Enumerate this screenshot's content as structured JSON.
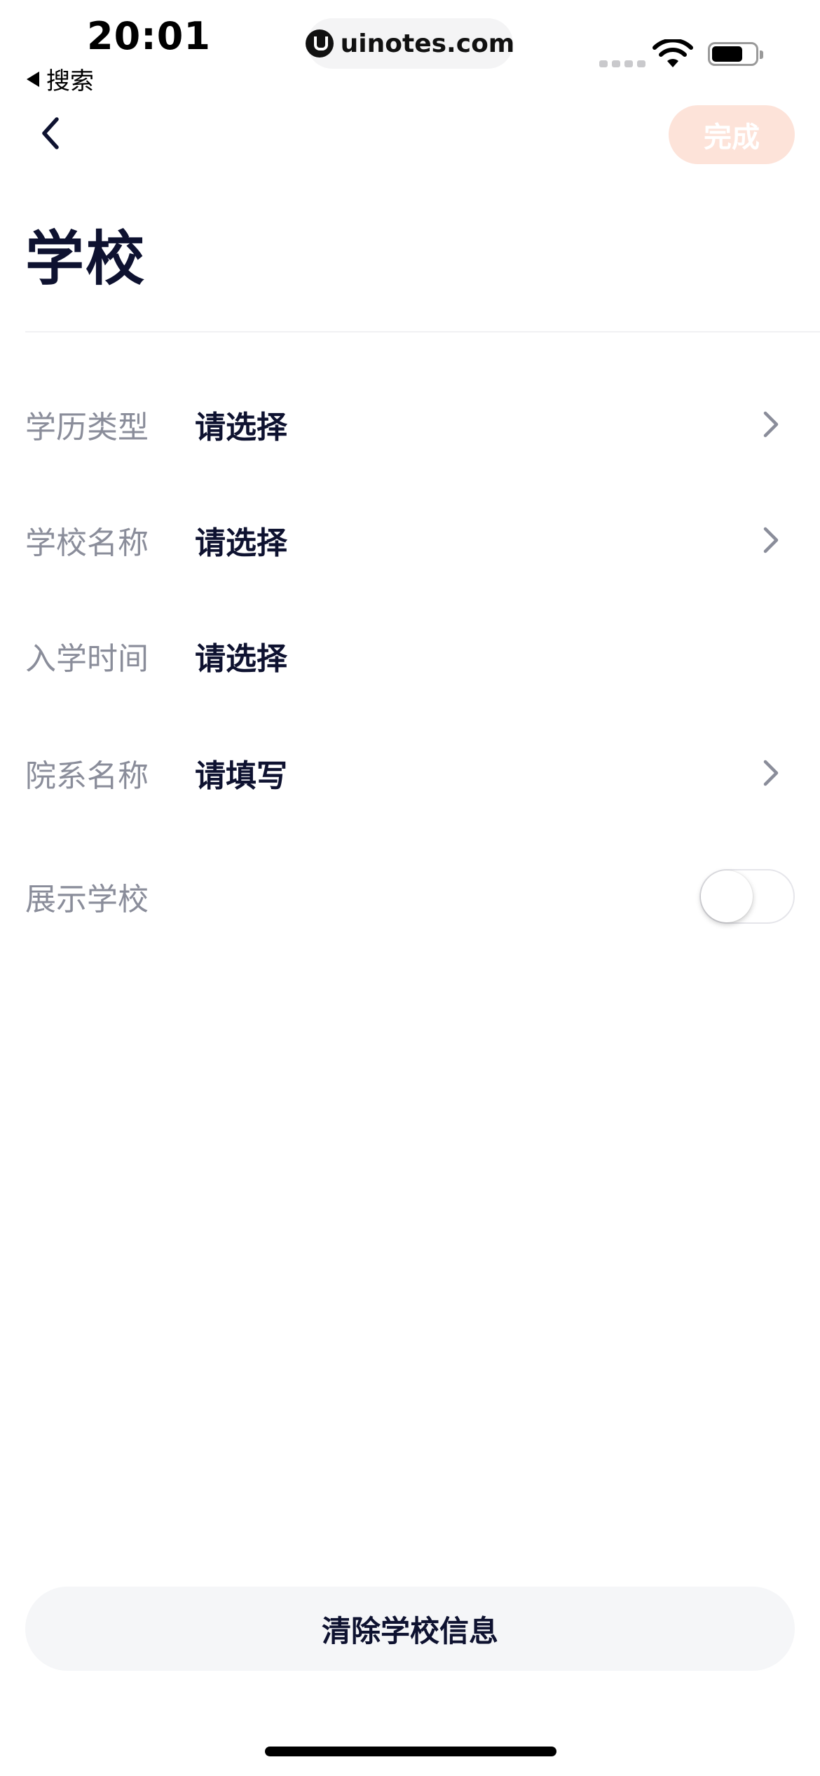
{
  "status_bar": {
    "time": "20:01",
    "back_app": "搜索",
    "url": "uinotes.com"
  },
  "nav": {
    "done_label": "完成"
  },
  "page": {
    "title": "学校"
  },
  "form": {
    "rows": [
      {
        "label": "学历类型",
        "value": "请选择"
      },
      {
        "label": "学校名称",
        "value": "请选择"
      },
      {
        "label": "入学时间",
        "value": "请选择"
      },
      {
        "label": "院系名称",
        "value": "请填写"
      }
    ],
    "show_school": {
      "label": "展示学校",
      "enabled": false
    }
  },
  "footer": {
    "clear_label": "清除学校信息"
  },
  "colors": {
    "primary_text": "#0e1230",
    "label_text": "#8a8d9a",
    "done_button_bg": "#fde3d9",
    "clear_button_bg": "#f5f6f8"
  }
}
